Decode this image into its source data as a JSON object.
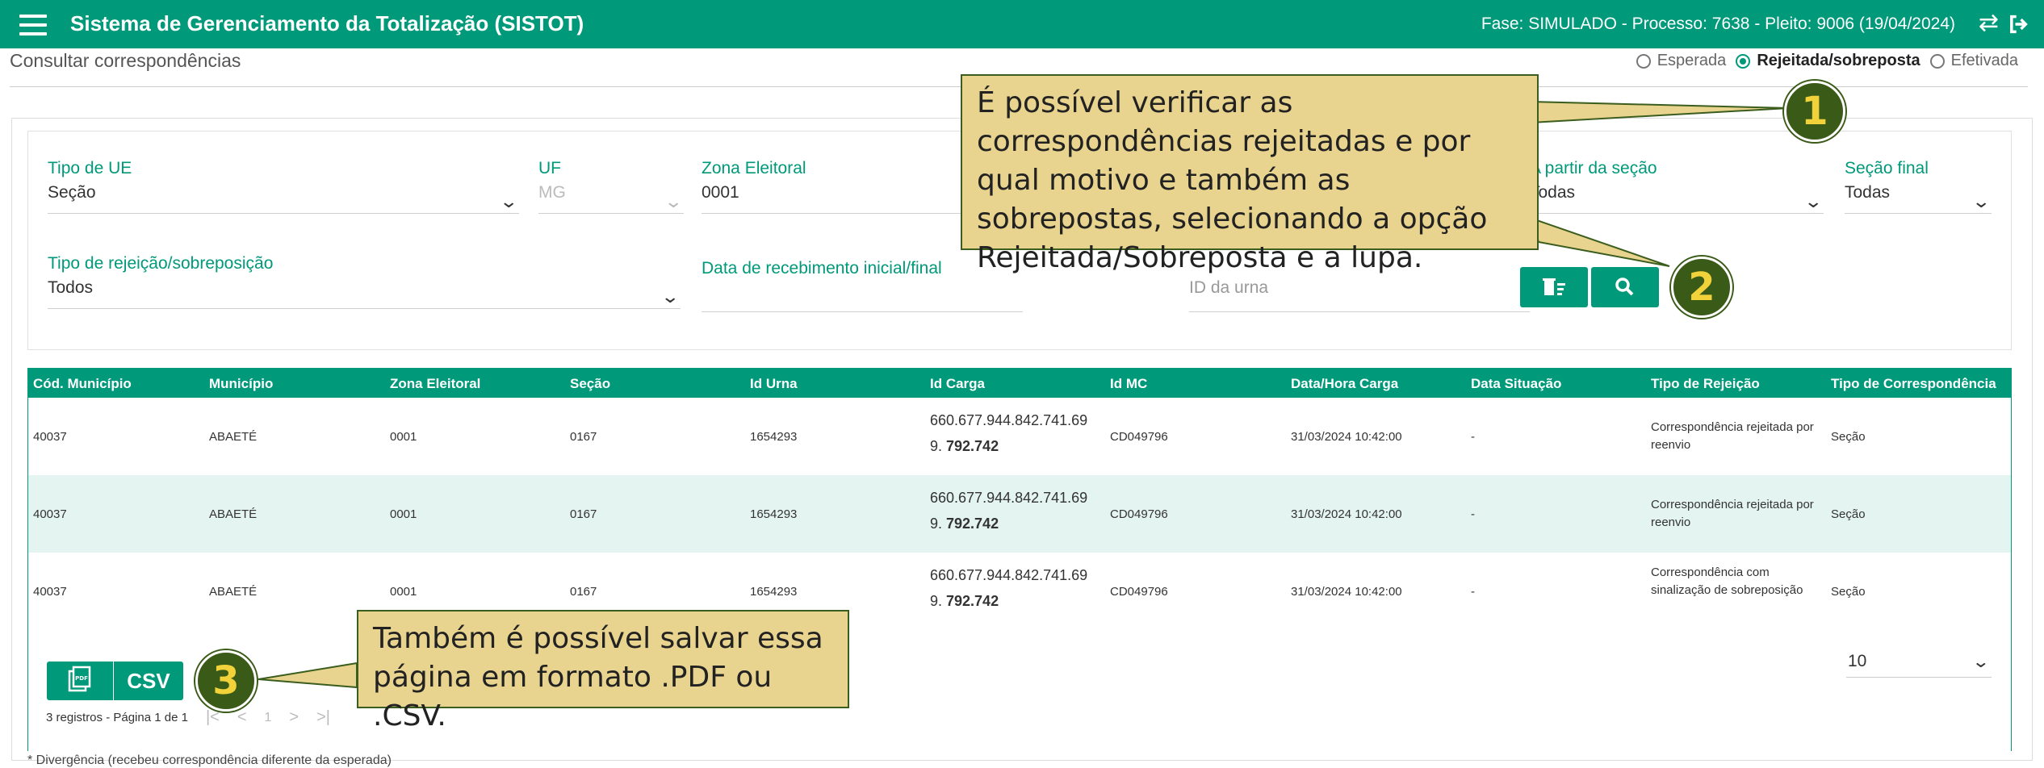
{
  "header": {
    "app_title": "Sistema de Gerenciamento da Totalização (SISTOT)",
    "process_info": "Fase: SIMULADO - Processo: 7638 - Pleito: 9006 (19/04/2024)"
  },
  "page_title": "Consultar correspondências",
  "radio_options": [
    "Esperada",
    "Rejeitada/sobreposta",
    "Efetivada"
  ],
  "radio_selected": "Rejeitada/sobreposta",
  "filters": {
    "tipo_ue": {
      "label": "Tipo de UE",
      "value": "Seção"
    },
    "uf": {
      "label": "UF",
      "value": "MG"
    },
    "zona": {
      "label": "Zona Eleitoral",
      "value": "0001"
    },
    "secao_inicial": {
      "label": "A partir da seção",
      "value": "Todas"
    },
    "secao_final": {
      "label": "Seção final",
      "value": "Todas"
    },
    "tipo_rejeicao": {
      "label": "Tipo de rejeição/sobreposição",
      "value": "Todos"
    },
    "data_recebimento": {
      "label": "Data de recebimento inicial/final",
      "value": ""
    },
    "id_urna": {
      "placeholder": "ID da urna"
    }
  },
  "table": {
    "headers": [
      "Cód. Município",
      "Município",
      "Zona Eleitoral",
      "Seção",
      "Id Urna",
      "Id Carga",
      "Id MC",
      "Data/Hora Carga",
      "Data Situação",
      "Tipo de Rejeição",
      "Tipo de Correspondência"
    ],
    "rows": [
      {
        "cod": "40037",
        "municipio": "ABAETÉ",
        "zona": "0001",
        "secao": "0167",
        "urna": "1654293",
        "carga_1": "660.677.944.842.741.69",
        "carga_2_prefix": "9. ",
        "carga_2_bold": "792.742",
        "mc": "CD049796",
        "data_carga": "31/03/2024 10:42:00",
        "data_situacao": "-",
        "tipo_rejeicao": "Correspondência rejeitada por reenvio",
        "tipo_corresp": "Seção"
      },
      {
        "cod": "40037",
        "municipio": "ABAETÉ",
        "zona": "0001",
        "secao": "0167",
        "urna": "1654293",
        "carga_1": "660.677.944.842.741.69",
        "carga_2_prefix": "9. ",
        "carga_2_bold": "792.742",
        "mc": "CD049796",
        "data_carga": "31/03/2024 10:42:00",
        "data_situacao": "-",
        "tipo_rejeicao": "Correspondência rejeitada por reenvio",
        "tipo_corresp": "Seção"
      },
      {
        "cod": "40037",
        "municipio": "ABAETÉ",
        "zona": "0001",
        "secao": "0167",
        "urna": "1654293",
        "carga_1": "660.677.944.842.741.69",
        "carga_2_prefix": "9. ",
        "carga_2_bold": "792.742",
        "mc": "CD049796",
        "data_carga": "31/03/2024 10:42:00",
        "data_situacao": "-",
        "tipo_rejeicao": "Correspondência com sinalização de sobreposição",
        "tipo_corresp": "Seção"
      }
    ]
  },
  "export": {
    "pdf_label": "PDF",
    "csv_label": "CSV"
  },
  "paging": {
    "summary": "3 registros - Página 1 de 1",
    "page": "1",
    "per_page": "10"
  },
  "footer_note": "* Divergência (recebeu correspondência diferente da esperada)",
  "callouts": {
    "c1": {
      "number": "1",
      "text": "É possível verificar as correspondências rejeitadas e por qual motivo e também as sobrepostas, selecionando a opção Rejeitada/Sobreposta e a lupa."
    },
    "c2": {
      "number": "2"
    },
    "c3": {
      "number": "3",
      "text": "Também é possível salvar essa página em formato .PDF ou .CSV."
    }
  },
  "colors": {
    "primary": "#00997a",
    "callout_bg": "#e8d48f",
    "badge": "#3a5a17",
    "badge_text": "#f2d23a"
  }
}
